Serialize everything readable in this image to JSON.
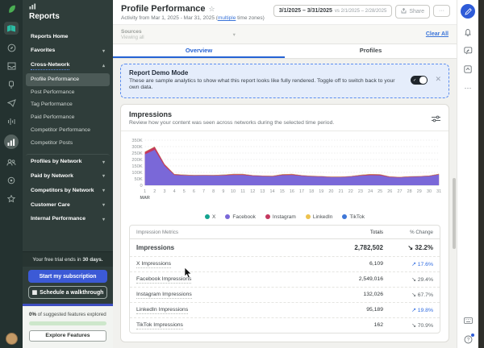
{
  "icons": {
    "star": "☆",
    "ellipsis": "···",
    "close": "✕",
    "check": "✓",
    "chevron_down": "▾",
    "calendar": "▦"
  },
  "icon_rail": {
    "items": [
      "sprout-leaf-logo",
      "plan-icon",
      "discover-icon",
      "inbox-icon",
      "notifications-icon",
      "publishing-icon",
      "listening-icon",
      "reports-icon",
      "audience-icon",
      "settings-icon",
      "rewards-icon",
      "user-avatar"
    ]
  },
  "sidebar": {
    "title": "Reports",
    "items": [
      {
        "label": "Reports Home",
        "is_section": true
      },
      {
        "label": "Favorites",
        "is_section": true,
        "chevron": "▾"
      },
      {
        "label": "Cross-Network",
        "is_section": true,
        "chevron": "▴",
        "underline": true
      },
      {
        "label": "Profile Performance",
        "active": true
      },
      {
        "label": "Post Performance"
      },
      {
        "label": "Tag Performance"
      },
      {
        "label": "Paid Performance"
      },
      {
        "label": "Competitor Performance"
      },
      {
        "label": "Competitor Posts"
      },
      {
        "label": "Profiles by Network",
        "is_section": true,
        "chevron": "▾",
        "divider_above": true
      },
      {
        "label": "Paid by Network",
        "is_section": true,
        "chevron": "▾"
      },
      {
        "label": "Competitors by Network",
        "is_section": true,
        "chevron": "▾"
      },
      {
        "label": "Customer Care",
        "is_section": true,
        "chevron": "▾"
      },
      {
        "label": "Internal Performance",
        "is_section": true,
        "chevron": "▾"
      }
    ],
    "trial": {
      "text_prefix": "Your free trial ends in ",
      "text_bold": "30 days.",
      "subscribe_label": "Start my subscription",
      "walkthrough_label": "Schedule a walkthrough"
    },
    "features_card": {
      "percent": "0%",
      "text": " of suggested features explored",
      "button_label": "Explore Features"
    }
  },
  "header": {
    "title": "Profile Performance",
    "subtitle_prefix": "Activity from Mar 1, 2025 - Mar 31, 2025 (",
    "subtitle_link": "multiple",
    "subtitle_suffix": " time zones)",
    "date_range": "3/1/2025 – 3/31/2025",
    "compare_range": "vs 2/1/2025 – 2/28/2025",
    "share_label": "Share",
    "more_label": "···"
  },
  "sources": {
    "label": "Sources",
    "value": "Viewing all",
    "clear_all": "Clear All"
  },
  "tabs": [
    {
      "label": "Overview",
      "active": true
    },
    {
      "label": "Profiles",
      "active": false
    }
  ],
  "demo_banner": {
    "title": "Report Demo Mode",
    "body": "These are sample analytics to show what this report looks like fully rendered. Toggle off to switch back to your own data."
  },
  "impressions_card": {
    "title": "Impressions",
    "subtitle": "Review how your content was seen across networks during the selected time period."
  },
  "chart_data": {
    "type": "area",
    "stacked": true,
    "title": "Impressions",
    "x_axis_label": "MAR",
    "x": [
      1,
      2,
      3,
      4,
      5,
      6,
      7,
      8,
      9,
      10,
      11,
      12,
      13,
      14,
      15,
      16,
      17,
      18,
      19,
      20,
      21,
      22,
      23,
      24,
      25,
      26,
      27,
      28,
      29,
      30,
      31
    ],
    "ylim": [
      0,
      350000
    ],
    "y_ticks": [
      "0",
      "50K",
      "100K",
      "150K",
      "200K",
      "250K",
      "300K",
      "350K"
    ],
    "grid": "dotted-horizontal",
    "legend_position": "bottom",
    "series": [
      {
        "name": "X",
        "color": "#14a38f",
        "values": [
          200,
          200,
          200,
          200,
          200,
          200,
          200,
          200,
          200,
          200,
          200,
          200,
          200,
          200,
          200,
          200,
          200,
          200,
          200,
          200,
          200,
          200,
          200,
          200,
          200,
          200,
          200,
          200,
          200,
          200,
          200
        ]
      },
      {
        "name": "Facebook",
        "color": "#7a68d8",
        "values": [
          240000,
          275000,
          150000,
          80000,
          76000,
          74000,
          75000,
          74000,
          76000,
          80000,
          80000,
          72000,
          70000,
          68000,
          78000,
          80000,
          72000,
          68000,
          66000,
          62000,
          62000,
          66000,
          74000,
          78000,
          76000,
          62000,
          60000,
          64000,
          66000,
          70000,
          82000
        ]
      },
      {
        "name": "Instagram",
        "color": "#c4385f",
        "values": [
          18000,
          22000,
          12000,
          5000,
          4000,
          3000,
          3000,
          3000,
          4000,
          5000,
          5000,
          4000,
          3000,
          3000,
          5000,
          5000,
          4000,
          3000,
          3000,
          3000,
          3000,
          3000,
          4000,
          6000,
          6000,
          4000,
          3000,
          3000,
          3000,
          3000,
          4000
        ]
      },
      {
        "name": "LinkedIn",
        "color": "#edc24e",
        "values": [
          3000,
          3000,
          3000,
          2000,
          2000,
          2000,
          2000,
          2000,
          2000,
          3000,
          3000,
          2000,
          2000,
          2000,
          3000,
          3000,
          2000,
          2000,
          2000,
          2000,
          2000,
          2000,
          3000,
          3000,
          3000,
          2000,
          2000,
          2000,
          2000,
          2000,
          3000
        ]
      },
      {
        "name": "TikTok",
        "color": "#3f77d7",
        "values": [
          5,
          5,
          5,
          5,
          5,
          5,
          5,
          5,
          5,
          5,
          5,
          5,
          5,
          5,
          5,
          5,
          5,
          5,
          5,
          5,
          5,
          5,
          5,
          5,
          5,
          5,
          5,
          5,
          5,
          5,
          5
        ]
      }
    ]
  },
  "table": {
    "columns": [
      "Impression Metrics",
      "Totals",
      "% Change"
    ],
    "rows": [
      {
        "metric": "Impressions",
        "total": "2,782,502",
        "arrow": "↘",
        "change": "32.2%",
        "emphasis": true
      },
      {
        "metric": "X Impressions",
        "total": "6,109",
        "arrow": "↗",
        "change": "17.6%",
        "is_up": true
      },
      {
        "metric": "Facebook Impressions",
        "total": "2,549,016",
        "arrow": "↘",
        "change": "29.4%"
      },
      {
        "metric": "Instagram Impressions",
        "total": "132,026",
        "arrow": "↘",
        "change": "67.7%"
      },
      {
        "metric": "LinkedIn Impressions",
        "total": "95,189",
        "arrow": "↗",
        "change": "19.8%",
        "is_up": true
      },
      {
        "metric": "TikTok Impressions",
        "total": "162",
        "arrow": "↘",
        "change": "70.9%"
      }
    ]
  },
  "right_rail": {
    "items": [
      "compose-button",
      "notifications-bell-icon",
      "message-edit-icon",
      "window-icon",
      "more-ellipsis",
      "keyboard-icon",
      "help-icon"
    ]
  }
}
